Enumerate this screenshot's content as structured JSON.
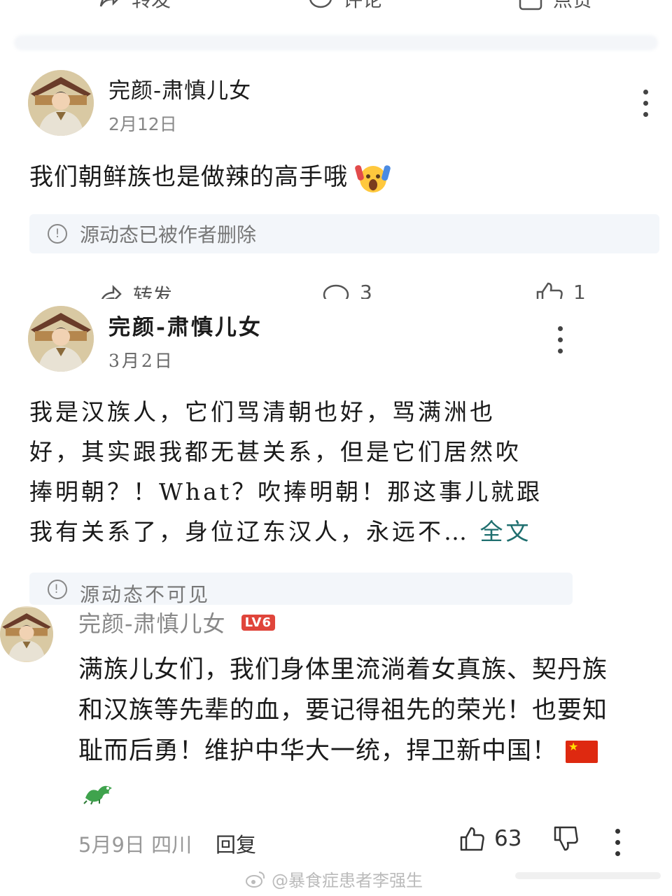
{
  "top_bar": {
    "repost": "转发",
    "comment": "评论",
    "like": "点赞"
  },
  "post1": {
    "username": "完颜-肃慎儿女",
    "date": "2月12日",
    "text": "我们朝鲜族也是做辣的高手哦",
    "source_notice": "源动态已被作者删除",
    "actions": {
      "repost": "转发",
      "comments": "3",
      "likes": "1"
    }
  },
  "post2": {
    "username": "完颜-肃慎儿女",
    "date": "3月2日",
    "lines": [
      "我是汉族人，它们骂清朝也好，骂满洲也",
      "好，其实跟我都无甚关系，但是它们居然吹",
      "捧明朝？！What？吹捧明朝！那这事儿就跟",
      "我有关系了，身位辽东汉人，永远不"
    ],
    "ellipsis": "…",
    "full_text_link": "全文",
    "source_notice": "源动态不可见"
  },
  "comment": {
    "username": "完颜-肃慎儿女",
    "level_badge": "LV6",
    "text": "满族儿女们，我们身体里流淌着女真族、契丹族和汉族等先辈的血，要记得祖先的荣光！也要知耻而后勇！维护中华大一统，捍卫新中国！",
    "date_location": "5月9日 四川",
    "reply_label": "回复",
    "likes": "63"
  },
  "watermark": "@暴食症患者李强生",
  "colors": {
    "link": "#1f6f6f",
    "badge": "#e0453b",
    "notice_bg": "#f3f6fa"
  }
}
